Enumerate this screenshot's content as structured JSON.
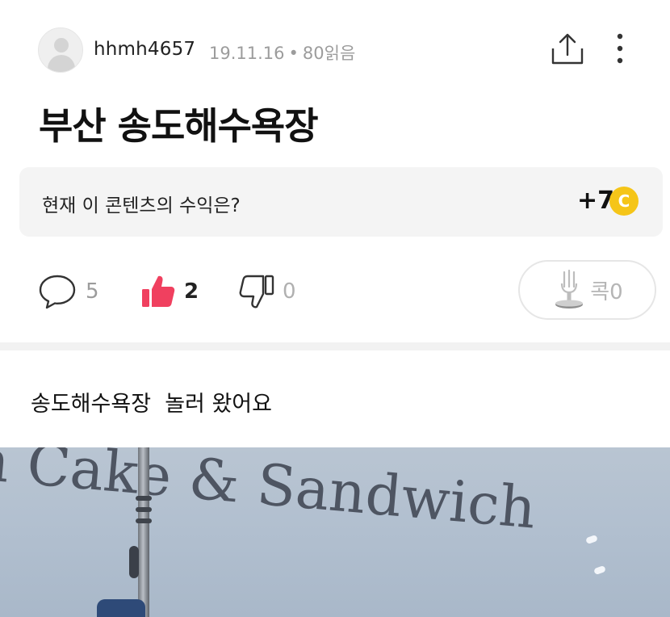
{
  "author": {
    "username": "hhmh4657",
    "date": "19.11.16",
    "separator": "•",
    "views": "80읽음"
  },
  "post": {
    "title": "부산 송도해수욕장",
    "body": "송도해수욕장  놀러 왔어요"
  },
  "revenue": {
    "label": "현재 이 콘텐츠의 수익은?",
    "value": "+7",
    "coin_symbol": "C",
    "coin_color": "#f5c518"
  },
  "actions": {
    "comments": "5",
    "likes": "2",
    "dislikes": "0",
    "kok_label": "콕0"
  },
  "photo": {
    "sign_text_fragment_1": "in Cake & Sandwich"
  },
  "colors": {
    "like_accent": "#f0405f",
    "meta_gray": "#9c9c9c"
  }
}
